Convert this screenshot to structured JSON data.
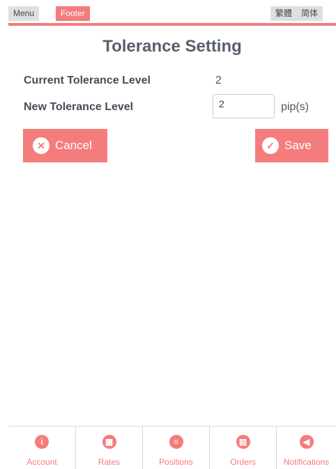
{
  "topbar": {
    "menu_label": "Menu",
    "footer_label": "Footer",
    "traditional_label": "繁體",
    "simplified_label": "简体"
  },
  "page": {
    "title": "Tolerance Setting"
  },
  "form": {
    "current_label": "Current Tolerance Level",
    "current_value": "2",
    "new_label": "New Tolerance Level",
    "new_value": "2",
    "unit": "pip(s)"
  },
  "actions": {
    "cancel_label": "Cancel",
    "save_label": "Save"
  },
  "nav": {
    "items": [
      {
        "label": "Account",
        "icon": "info-icon"
      },
      {
        "label": "Rates",
        "icon": "grid-icon"
      },
      {
        "label": "Positions",
        "icon": "list-icon"
      },
      {
        "label": "Orders",
        "icon": "calendar-icon"
      },
      {
        "label": "Notifications",
        "icon": "speaker-icon"
      }
    ]
  },
  "colors": {
    "accent": "#f57c7c",
    "text": "#4a5563"
  }
}
